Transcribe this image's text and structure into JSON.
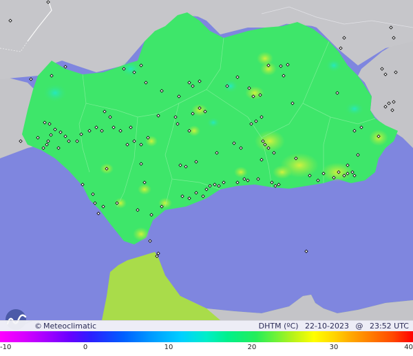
{
  "brand": {
    "copyright": "©",
    "name": "Meteoclimatic"
  },
  "product": {
    "variable": "DHTM (ºC)",
    "date": "22-10-2023",
    "at": "@",
    "time": "23:52 UTC"
  },
  "legend": {
    "ticks": [
      "-10",
      "0",
      "10",
      "20",
      "30",
      "40"
    ],
    "min": -10,
    "max": 40
  },
  "colors": {
    "sea": "#7f86df",
    "land_outside": "#c4c4c8",
    "andalusia": "#3ee66a",
    "morocco": "#a9dc4a",
    "station_marker": "#111111"
  },
  "map": {
    "region": "Andalucía",
    "stations_shown": true
  }
}
